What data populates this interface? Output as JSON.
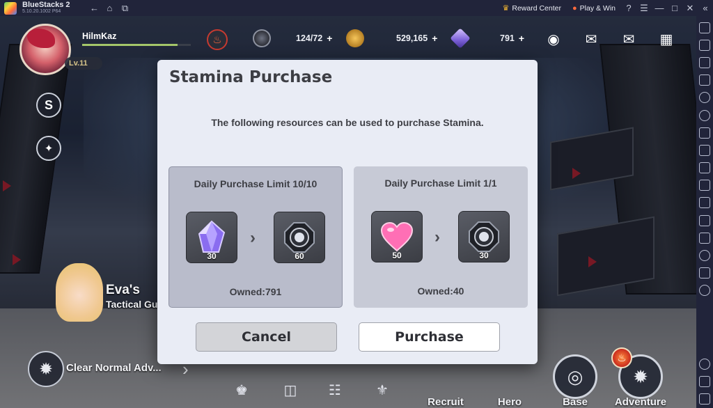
{
  "window": {
    "app_name": "BlueStacks 2",
    "version": "5.10.20.1002 P64",
    "reward_center_label": "Reward Center",
    "play_win_label": "Play & Win"
  },
  "hud": {
    "username": "HilmKaz",
    "level": "Lv.11",
    "exp_progress": 0.88,
    "stamina": "124/72",
    "gold": "529,165",
    "crystals": "791"
  },
  "character_banner": {
    "name": "Eva's",
    "subtitle": "Tactical Gu"
  },
  "bottom_menu": {
    "quest_text": "Clear Normal Adv...",
    "recruit": "Recruit",
    "hero": "Hero",
    "base": "Base",
    "adventure": "Adventure"
  },
  "dialog": {
    "title": "Stamina Purchase",
    "description": "The following resources can be used to purchase Stamina.",
    "options": [
      {
        "limit": "Daily Purchase Limit 10/10",
        "cost_qty": "30",
        "cost_icon": "crystal-icon",
        "reward_qty": "60",
        "reward_icon": "stamina-gear-icon",
        "owned": "Owned:791"
      },
      {
        "limit": "Daily Purchase Limit 1/1",
        "cost_qty": "50",
        "cost_icon": "heart-icon",
        "reward_qty": "30",
        "reward_icon": "stamina-gear-icon",
        "owned": "Owned:40"
      }
    ],
    "cancel_label": "Cancel",
    "purchase_label": "Purchase"
  },
  "colors": {
    "dialog_bg": "#e9ecf5",
    "option_selected": "#b9bccb",
    "titlebar": "#21243a",
    "reward_crown": "#f2b632",
    "play_win": "#ff6a3d"
  }
}
